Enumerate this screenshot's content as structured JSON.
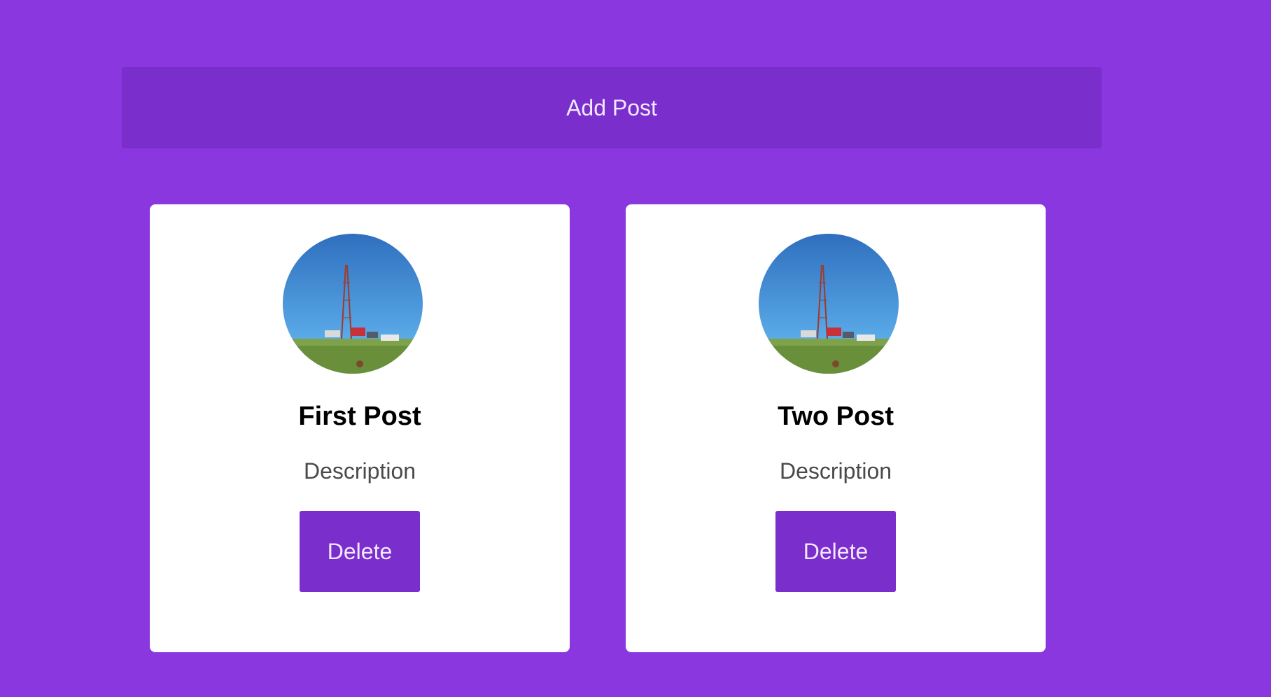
{
  "header": {
    "add_post_label": "Add Post"
  },
  "posts": [
    {
      "title": "First Post",
      "description": "Description",
      "delete_label": "Delete"
    },
    {
      "title": "Two Post",
      "description": "Description",
      "delete_label": "Delete"
    }
  ],
  "colors": {
    "background": "#8a37df",
    "button": "#7a2ecb",
    "card": "#ffffff"
  }
}
